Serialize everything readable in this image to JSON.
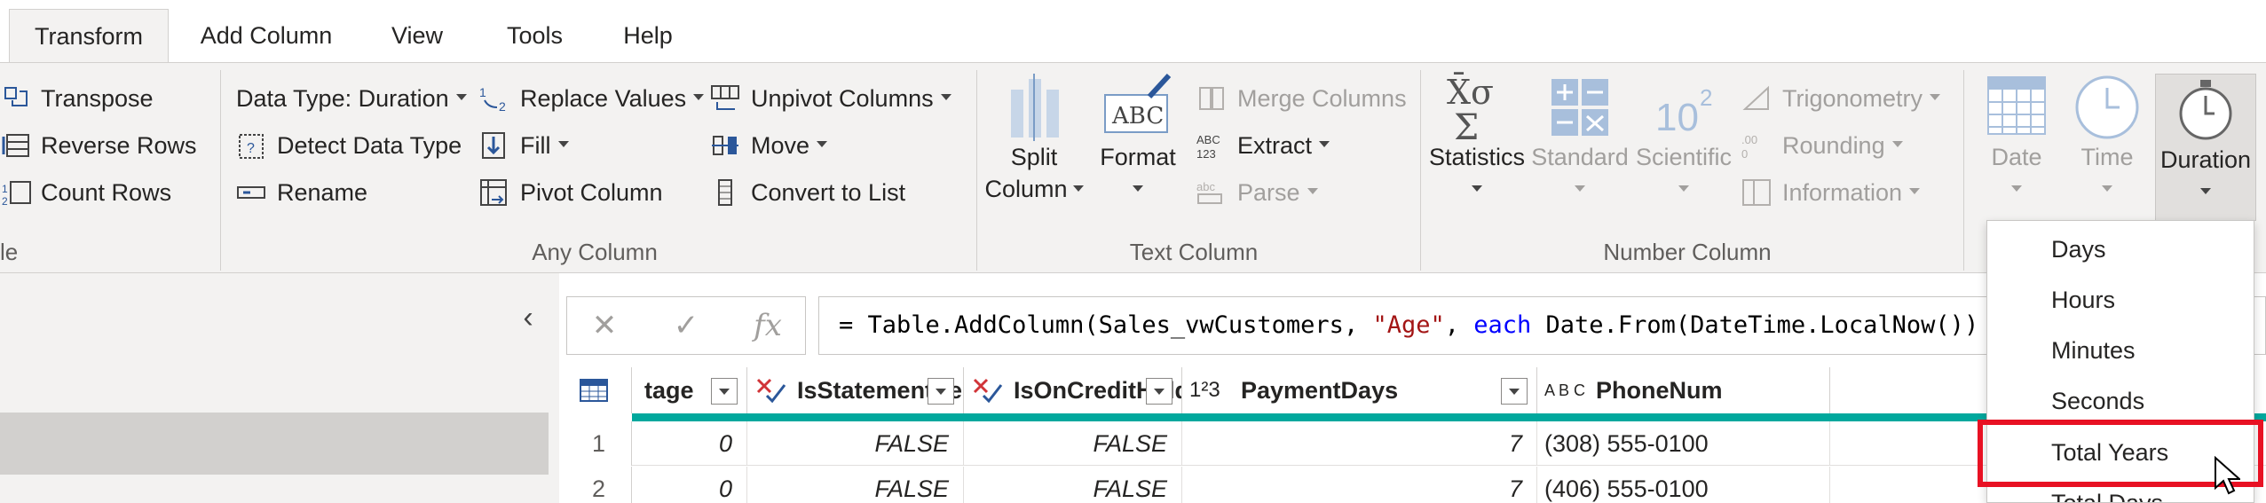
{
  "tabs": [
    {
      "label": "Transform"
    },
    {
      "label": "Add Column"
    },
    {
      "label": "View"
    },
    {
      "label": "Tools"
    },
    {
      "label": "Help"
    }
  ],
  "ribbon": {
    "table_group": {
      "partial_label": "le",
      "items": [
        "Transpose",
        "Reverse Rows",
        "Count Rows"
      ]
    },
    "any_column": {
      "label": "Any Column",
      "data_type": "Data Type: Duration",
      "detect_data_type": "Detect Data Type",
      "rename": "Rename",
      "replace_values": "Replace Values",
      "fill": "Fill",
      "pivot_column": "Pivot Column",
      "unpivot_columns": "Unpivot Columns",
      "move": "Move",
      "convert_to_list": "Convert to List"
    },
    "text_column": {
      "label": "Text Column",
      "split_column_1": "Split",
      "split_column_2": "Column",
      "format": "Format",
      "merge_columns": "Merge Columns",
      "extract": "Extract",
      "parse": "Parse"
    },
    "number_column": {
      "label": "Number Column",
      "statistics": "Statistics",
      "standard": "Standard",
      "scientific": "Scientific",
      "trigonometry": "Trigonometry",
      "rounding": "Rounding",
      "information": "Information"
    },
    "datetime": {
      "date": "Date",
      "time": "Time",
      "duration": "Duration"
    }
  },
  "formula_bar": {
    "cancel": "✕",
    "commit": "✓",
    "fx": "fx",
    "prefix": "= Table.AddColumn(Sales_vwCustomers, ",
    "string": "\"Age\"",
    "comma": ", ",
    "keyword": "each",
    "suffix": " Date.From(DateTime.LocalNow())"
  },
  "grid": {
    "columns": [
      {
        "name": "tage",
        "type_icon": "number-icon"
      },
      {
        "name": "IsStatementSent",
        "type_icon": "logical-icon"
      },
      {
        "name": "IsOnCreditHold",
        "type_icon": "logical-icon"
      },
      {
        "name": "PaymentDays",
        "type_icon": "whole-number-icon"
      },
      {
        "name": "PhoneNum",
        "type_icon": "text-icon"
      }
    ],
    "type_label_123": "1²3",
    "type_label_abc": "A B C",
    "rows": [
      {
        "n": "1",
        "tage": "0",
        "IsStatementSent": "FALSE",
        "IsOnCreditHold": "FALSE",
        "PaymentDays": "7",
        "PhoneNum": "(308) 555-0100"
      },
      {
        "n": "2",
        "tage": "0",
        "IsStatementSent": "FALSE",
        "IsOnCreditHold": "FALSE",
        "PaymentDays": "7",
        "PhoneNum": "(406) 555-0100"
      }
    ]
  },
  "duration_menu": {
    "items": [
      "Days",
      "Hours",
      "Minutes",
      "Seconds",
      "Total Years",
      "Total Days"
    ],
    "highlighted": "Total Years"
  },
  "colors": {
    "accent_teal": "#00a89d",
    "highlight_red": "#e81123",
    "ribbon_bg": "#f3f2f1"
  }
}
